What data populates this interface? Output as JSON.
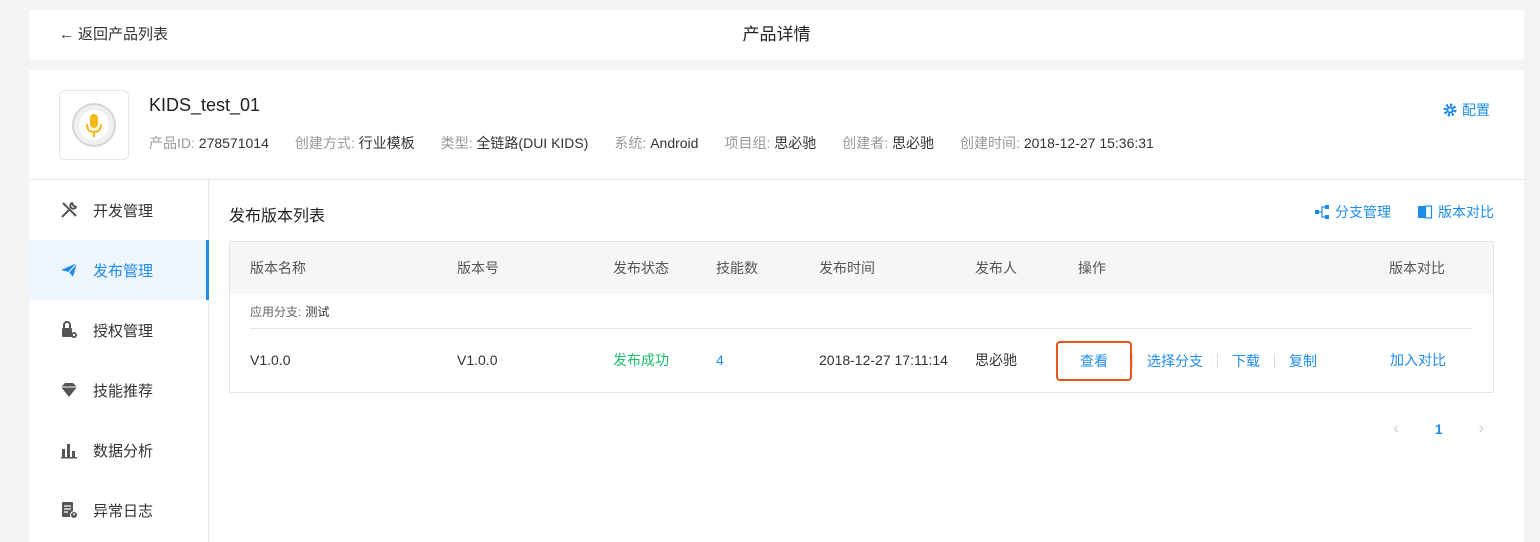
{
  "header": {
    "back_label": "返回产品列表",
    "title": "产品详情"
  },
  "product": {
    "name": "KIDS_test_01",
    "config_label": "配置",
    "meta": [
      {
        "key": "产品ID:",
        "value": "278571014"
      },
      {
        "key": "创建方式:",
        "value": "行业模板"
      },
      {
        "key": "类型:",
        "value": "全链路(DUI KIDS)"
      },
      {
        "key": "系统:",
        "value": "Android"
      },
      {
        "key": "项目组:",
        "value": "思必驰"
      },
      {
        "key": "创建者:",
        "value": "思必驰"
      },
      {
        "key": "创建时间:",
        "value": "2018-12-27 15:36:31"
      }
    ]
  },
  "sidebar": {
    "items": [
      {
        "label": "开发管理",
        "icon": "tools-icon"
      },
      {
        "label": "发布管理",
        "icon": "paper-plane-icon",
        "active": true
      },
      {
        "label": "授权管理",
        "icon": "lock-gear-icon"
      },
      {
        "label": "技能推荐",
        "icon": "diamond-icon"
      },
      {
        "label": "数据分析",
        "icon": "bar-chart-icon"
      },
      {
        "label": "异常日志",
        "icon": "log-alert-icon"
      }
    ]
  },
  "main": {
    "section_title": "发布版本列表",
    "branch_manage_label": "分支管理",
    "version_compare_label": "版本对比",
    "columns": [
      "版本名称",
      "版本号",
      "发布状态",
      "技能数",
      "发布时间",
      "发布人",
      "操作",
      "版本对比"
    ],
    "group": {
      "key": "应用分支:",
      "value": "测试"
    },
    "rows": [
      {
        "name": "V1.0.0",
        "version": "V1.0.0",
        "status": "发布成功",
        "skills": "4",
        "time": "2018-12-27 17:11:14",
        "publisher": "思必驰",
        "ops": [
          "查看",
          "选择分支",
          "下载",
          "复制"
        ],
        "compare": "加入对比"
      }
    ]
  },
  "pagination": {
    "current": "1",
    "prev_icon": "chevron-left-icon",
    "next_icon": "chevron-right-icon"
  },
  "colors": {
    "accent": "#1f8ceb",
    "success": "#19be6b",
    "highlight": "#e8541c"
  }
}
